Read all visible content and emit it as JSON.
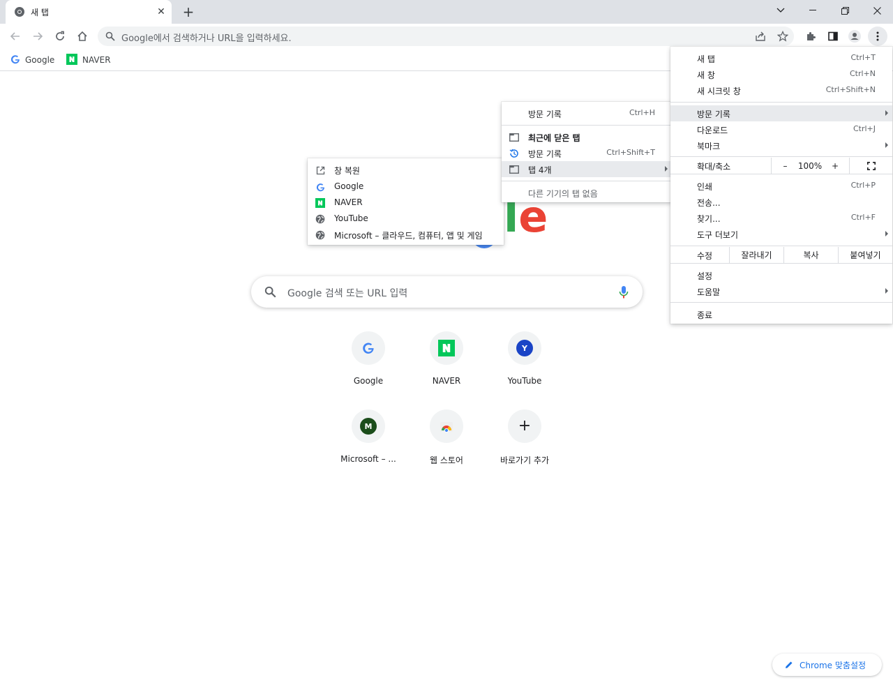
{
  "browser": {
    "tab_title": "새 탭",
    "tab_close": "✕",
    "new_tab": "+",
    "omnibox_placeholder": "Google에서 검색하거나 URL을 입력하세요."
  },
  "bookmarks": [
    {
      "label": "Google"
    },
    {
      "label": "NAVER"
    }
  ],
  "page": {
    "search_placeholder": "Google 검색 또는 URL 입력",
    "shortcuts": [
      {
        "label": "Google",
        "letter": "G"
      },
      {
        "label": "NAVER",
        "letter": "N"
      },
      {
        "label": "YouTube",
        "letter": "Y"
      },
      {
        "label": "Microsoft – ...",
        "letter": "M"
      },
      {
        "label": "웹 스토어",
        "letter": ""
      },
      {
        "label": "바로가기 추가",
        "letter": "+"
      }
    ],
    "customize_label": "Chrome 맞춤설정",
    "logo_partial": "le"
  },
  "main_menu": {
    "items": {
      "new_tab": {
        "label": "새 탭",
        "shortcut": "Ctrl+T"
      },
      "new_window": {
        "label": "새 창",
        "shortcut": "Ctrl+N"
      },
      "incognito": {
        "label": "새 시크릿 창",
        "shortcut": "Ctrl+Shift+N"
      },
      "history": {
        "label": "방문 기록"
      },
      "downloads": {
        "label": "다운로드",
        "shortcut": "Ctrl+J"
      },
      "bookmarks": {
        "label": "북마크"
      },
      "zoom": {
        "label": "확대/축소",
        "minus": "–",
        "value": "100%",
        "plus": "+"
      },
      "print": {
        "label": "인쇄",
        "shortcut": "Ctrl+P"
      },
      "cast": {
        "label": "전송..."
      },
      "find": {
        "label": "찾기...",
        "shortcut": "Ctrl+F"
      },
      "more_tools": {
        "label": "도구 더보기"
      },
      "edit": {
        "label": "수정",
        "cut": "잘라내기",
        "copy": "복사",
        "paste": "붙여넣기"
      },
      "settings": {
        "label": "설정"
      },
      "help": {
        "label": "도움말"
      },
      "exit": {
        "label": "종료"
      }
    }
  },
  "history_menu": {
    "history": {
      "label": "방문 기록",
      "shortcut": "Ctrl+H"
    },
    "recently_closed": {
      "label": "최근에 닫은 탭"
    },
    "history2": {
      "label": "방문 기록",
      "shortcut": "Ctrl+Shift+T"
    },
    "tabs4": {
      "label": "탭 4개"
    },
    "no_tabs": {
      "label": "다른 기기의 탭 없음"
    }
  },
  "tabs_menu": {
    "items": [
      {
        "label": "창 복원",
        "icon": "restore-window-icon"
      },
      {
        "label": "Google",
        "icon": "google-icon"
      },
      {
        "label": "NAVER",
        "icon": "naver-icon"
      },
      {
        "label": "YouTube",
        "icon": "globe-icon"
      },
      {
        "label": "Microsoft – 클라우드, 컴퓨터, 앱 및 게임",
        "icon": "globe-icon"
      }
    ]
  },
  "colors": {
    "accent": "#1a73e8",
    "naver_green": "#03c75a",
    "menu_highlight": "#e8eaed",
    "tabstrip": "#dee1e6"
  }
}
